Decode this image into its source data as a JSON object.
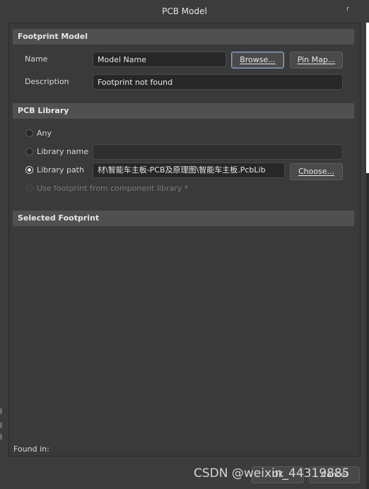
{
  "window": {
    "title": "PCB Model",
    "close_glyph": "r"
  },
  "footprint_model": {
    "header": "Footprint Model",
    "name_label": "Name",
    "name_value": "Model Name",
    "browse_label": "Browse...",
    "pin_map_label": "Pin Map...",
    "description_label": "Description",
    "description_value": "Footprint not found"
  },
  "pcb_library": {
    "header": "PCB Library",
    "options": {
      "any": "Any",
      "library_name": "Library name",
      "library_path": "Library path",
      "use_component_library": "Use footprint from component library *"
    },
    "selected_option": "library_path",
    "library_name_value": "",
    "library_path_value": "材\\智能车主板-PCB及原理图\\智能车主板.PcbLib",
    "choose_label": "Choose..."
  },
  "selected_footprint": {
    "header": "Selected Footprint"
  },
  "footer": {
    "found_in_label": "Found in:",
    "ok_label": "OK",
    "cancel_label": "Cancel"
  },
  "watermark": {
    "text": "CSDN @weixin_44319885"
  },
  "colors": {
    "background": "#3a3a3a",
    "section_header": "#505050",
    "field_background": "#272727",
    "button_background": "#4a4a4a",
    "focus_border": "#8fa6c6"
  }
}
